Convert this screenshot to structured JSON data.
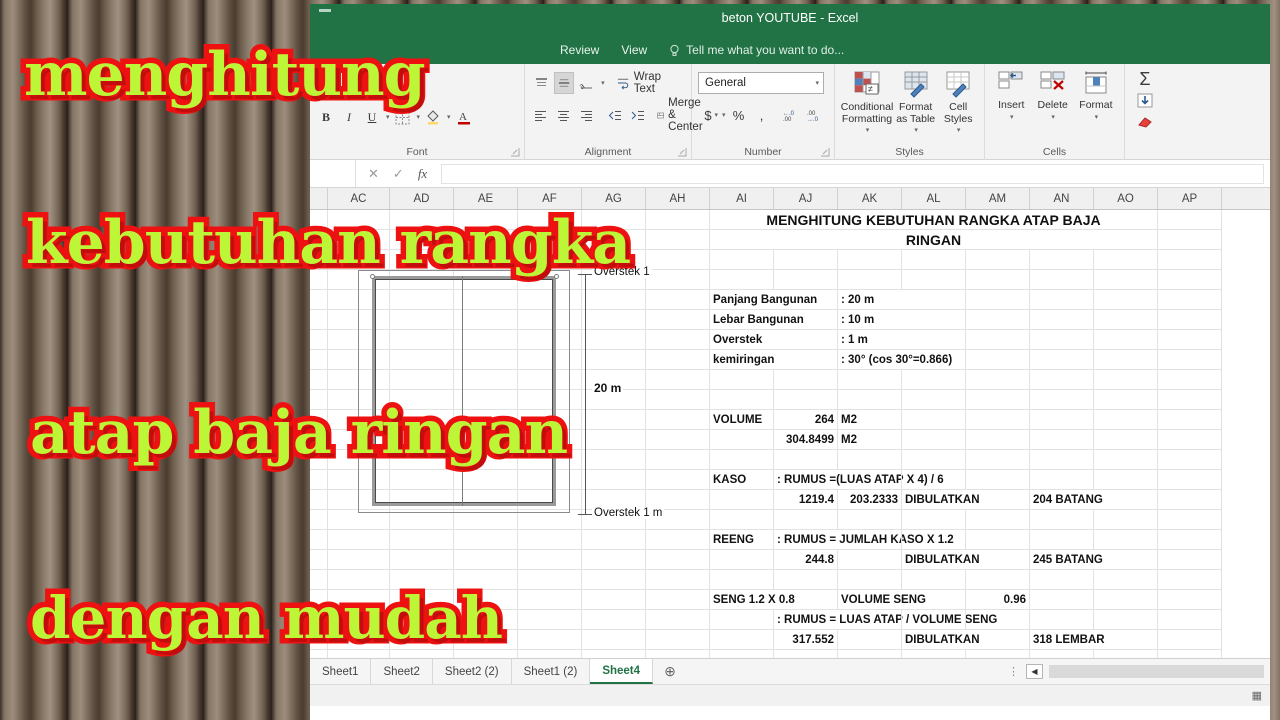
{
  "window": {
    "title": "beton YOUTUBE - Excel"
  },
  "ribbon": {
    "tabs": [
      "Review",
      "View"
    ],
    "tell_me": "Tell me what you want to do...",
    "groups": {
      "font": {
        "label": "Font",
        "bold": "B",
        "italic": "I",
        "underline": "U",
        "borders_icon": "borders-icon",
        "fill_icon": "fill-color-icon",
        "font_color_icon": "font-color-icon"
      },
      "alignment": {
        "label": "Alignment",
        "wrap_text": "Wrap Text",
        "merge_center": "Merge & Center",
        "align_top_icon": "align-top-icon",
        "align_middle_icon": "align-middle-icon",
        "orientation_icon": "text-orientation-icon",
        "align_left_icon": "align-left-icon",
        "align_center_icon": "align-center-icon",
        "align_right_icon": "align-right-icon",
        "decrease_indent_icon": "decrease-indent-icon",
        "increase_indent_icon": "increase-indent-icon"
      },
      "number": {
        "label": "Number",
        "format_value": "General",
        "currency": "$",
        "percent": "%",
        "comma": ",",
        "increase_decimal": ".00",
        "decrease_decimal": ".0"
      },
      "styles": {
        "label": "Styles",
        "conditional_formatting": "Conditional Formatting",
        "format_as_table": "Format as Table",
        "cell_styles": "Cell Styles"
      },
      "cells": {
        "label": "Cells",
        "insert": "Insert",
        "delete": "Delete",
        "format": "Format"
      },
      "editing": {
        "autosum_icon": "autosum-icon",
        "fill_icon": "fill-down-icon",
        "clear_icon": "clear-eraser-icon"
      }
    }
  },
  "formula_bar": {
    "name_box_value": "",
    "cancel_icon": "cancel-x-icon",
    "enter_icon": "confirm-check-icon",
    "function_icon": "insert-function-icon",
    "value": ""
  },
  "grid": {
    "columns": [
      "AC",
      "AD",
      "AE",
      "AF",
      "AG",
      "AH",
      "AI",
      "AJ",
      "AK",
      "AL",
      "AM",
      "AN",
      "AO",
      "AP"
    ],
    "sheet_title": "MENGHITUNG KEBUTUHAN RANGKA ATAP BAJA",
    "sheet_title_line2": "RINGAN",
    "parameters": [
      {
        "label": "Panjang Bangunan",
        "value": ": 20 m"
      },
      {
        "label": "Lebar Bangunan",
        "value": ": 10 m"
      },
      {
        "label": "Overstek",
        "value": ": 1 m"
      },
      {
        "label": "kemiringan",
        "value": ": 30° (cos 30°=0.866)"
      }
    ],
    "volume": {
      "label": "VOLUME",
      "value1": "264",
      "unit1": "M2",
      "value2": "304.8499",
      "unit2": "M2"
    },
    "kaso": {
      "label": "KASO",
      "formula": ": RUMUS =(LUAS ATAP X 4) / 6",
      "value1": "1219.4",
      "value2": "203.2333",
      "rounded_label": "DIBULATKAN",
      "result": "204 BATANG"
    },
    "reeng": {
      "label": "REENG",
      "formula": ": RUMUS = JUMLAH KASO X 1.2",
      "value1": "244.8",
      "rounded_label": "DIBULATKAN",
      "result": "245 BATANG"
    },
    "seng": {
      "label": "SENG 1.2 X 0.8",
      "volume_label": "VOLUME SENG",
      "volume_value": "0.96",
      "formula": ": RUMUS = LUAS ATAP / VOLUME SENG",
      "value1": "317.552",
      "rounded_label": "DIBULATKAN",
      "result": "318 LEMBAR"
    },
    "diagram": {
      "label_top": "Overstek 1",
      "label_bottom": "Overstek 1 m",
      "label_height": "20 m"
    }
  },
  "sheet_tabs": {
    "tabs": [
      "Sheet1",
      "Sheet2",
      "Sheet2 (2)",
      "Sheet1 (2)",
      "Sheet4"
    ],
    "active": "Sheet4",
    "add_sheet_icon": "add-sheet-plus-icon",
    "scroll_left_icon": "scroll-left-arrow-icon"
  },
  "status_bar": {
    "normal_view_icon": "normal-view-icon"
  },
  "overlay": {
    "line1": "menghitung",
    "line2": "kebutuhan rangka",
    "line3": "atap baja ringan",
    "line4": "dengan mudah",
    "text_color": "#bdf537",
    "outline_color": "#ee1111"
  }
}
